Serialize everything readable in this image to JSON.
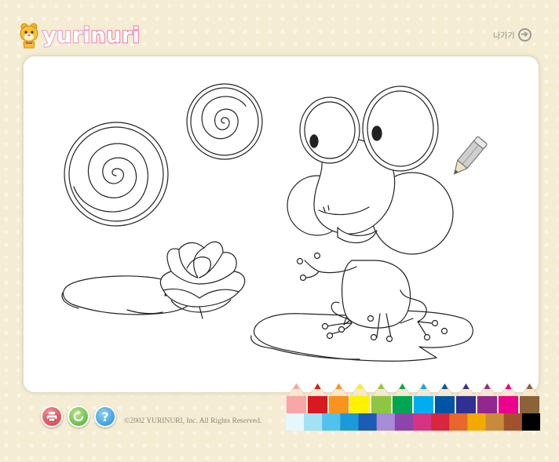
{
  "header": {
    "brand_part1": "yuri",
    "brand_part2": "nuri",
    "exit_label": "나가기",
    "exit_icon": "arrow-right-circle-icon"
  },
  "canvas": {
    "picture": "frog on a lily pad with lotus flower and spiral circles",
    "cursor_icon": "pencil-icon"
  },
  "toolbar": {
    "buttons": [
      {
        "name": "print-button",
        "icon": "printer-icon"
      },
      {
        "name": "reset-button",
        "icon": "refresh-icon"
      },
      {
        "name": "help-button",
        "icon": "help-icon",
        "label": "?"
      }
    ]
  },
  "footer": {
    "copyright": "©2002 YURINURI, Inc. All Rights Reserved."
  },
  "palette": {
    "top_row": [
      "#f9a6a8",
      "#d71920",
      "#f7941d",
      "#fff200",
      "#8dc63f",
      "#00a651",
      "#00aeef",
      "#0054a6",
      "#2e3192",
      "#92278f",
      "#ec008c",
      "#8c6239"
    ],
    "bottom_row": [
      "#e6f7fc",
      "#a3e1f5",
      "#4fc3ee",
      "#1a9ad9",
      "#1b5cb5",
      "#a98bd6",
      "#8e44ad",
      "#d63384",
      "#d7263d",
      "#e8672a",
      "#f2a900",
      "#c98b3a",
      "#a0522d",
      "#000000"
    ]
  }
}
